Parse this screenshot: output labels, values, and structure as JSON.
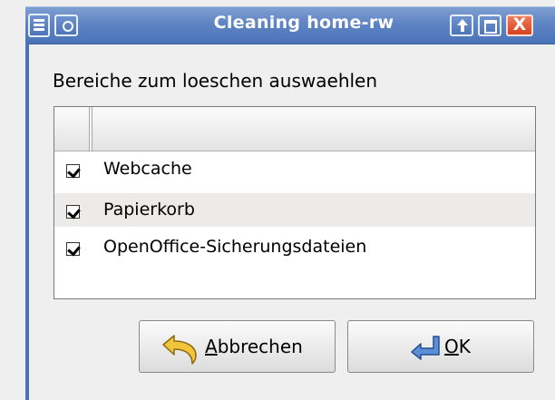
{
  "window": {
    "title": "Cleaning home-rw",
    "icons": [
      "menu-icon",
      "shade-icon",
      "raise-icon",
      "maximize-icon",
      "close-icon"
    ],
    "close_glyph": "X"
  },
  "dialog": {
    "prompt": "Bereiche zum loeschen auswaehlen",
    "items": [
      {
        "label": "Webcache",
        "checked": true
      },
      {
        "label": "Papierkorb",
        "checked": true
      },
      {
        "label": "OpenOffice-Sicherungsdateien",
        "checked": true
      }
    ]
  },
  "buttons": {
    "cancel": {
      "mnemonic": "A",
      "rest": "bbrechen",
      "icon": "undo-arrow-icon"
    },
    "ok": {
      "mnemonic": "O",
      "rest": "K",
      "icon": "return-arrow-icon"
    }
  },
  "colors": {
    "titlebar": "#5f84c4",
    "close_button": "#d8421e",
    "icon_yellow": "#f2c43a",
    "icon_blue": "#5b8fd6"
  }
}
